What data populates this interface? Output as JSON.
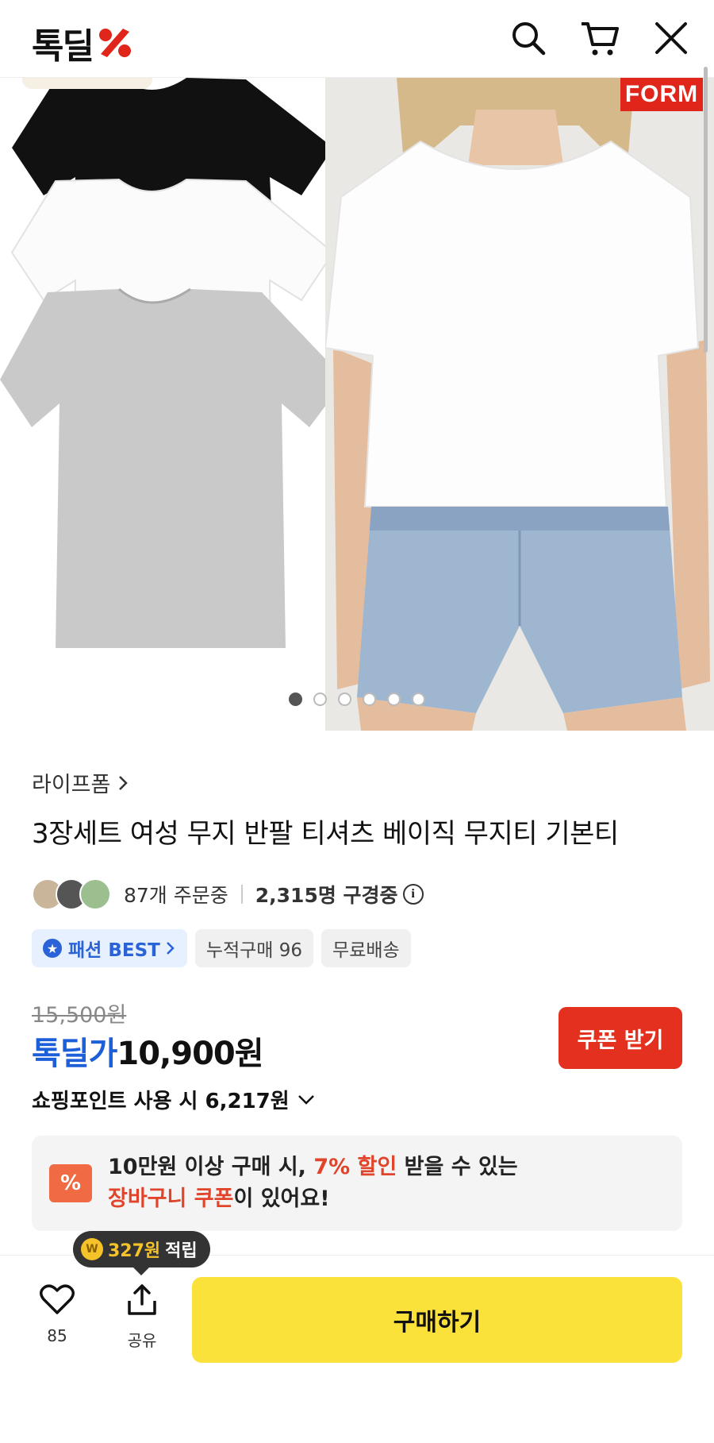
{
  "header": {
    "logo_text": "톡딜",
    "logo_symbol": "%"
  },
  "hero": {
    "badge": "FORM",
    "image_count": 6,
    "active_index": 0
  },
  "product": {
    "brand": "라이프폼",
    "title": "3장세트 여성 무지 반팔 티셔츠 베이직 무지티 기본티",
    "orders": "87개 주문중",
    "viewers": "2,315명 구경중",
    "tags": {
      "best": "패션 BEST",
      "cumulative": "누적구매 96",
      "shipping": "무료배송"
    },
    "original_price": "15,500원",
    "price_label": "톡딜가",
    "price": "10,900원",
    "coupon_button": "쿠폰 받기",
    "points_text": "쇼핑포인트 사용 시 6,217원"
  },
  "banner": {
    "line1_prefix": "10만원 이상 구매 시, ",
    "line1_highlight": "7% 할인",
    "line1_suffix": " 받을 수 있는",
    "line2_highlight": "장바구니 쿠폰",
    "line2_suffix": "이 있어요!",
    "icon": "%"
  },
  "bottom_bar": {
    "tooltip_amount": "327원",
    "tooltip_suffix": "적립",
    "like_count": "85",
    "share_label": "공유",
    "buy_button": "구매하기"
  },
  "colors": {
    "brand_red": "#e0261b",
    "price_blue": "#1d5fd8",
    "buy_yellow": "#fbe23b",
    "highlight_orange": "#e0452b"
  }
}
